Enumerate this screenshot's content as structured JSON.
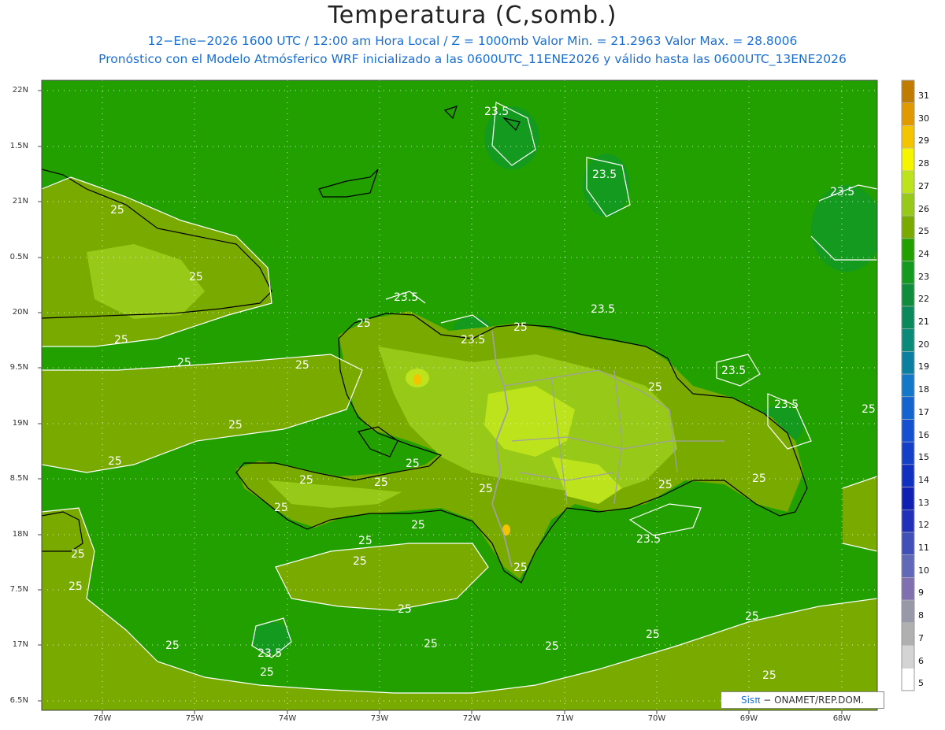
{
  "header": {
    "title": "Temperatura (C,somb.)",
    "subtitle1": "12−Ene−2026 1600 UTC / 12:00 am Hora Local / Z = 1000mb  Valor Min. = 21.2963  Valor Max. = 28.8006",
    "subtitle2": "Pronóstico con el Modelo Atmósferico WRF inicializado a las 0600UTC_11ENE2026 y válido hasta las  0600UTC_13ENE2026"
  },
  "axes": {
    "lat_labels": [
      "22N",
      "1.5N",
      "21N",
      "0.5N",
      "20N",
      "9.5N",
      "19N",
      "8.5N",
      "18N",
      "7.5N",
      "17N",
      "6.5N"
    ],
    "lon_labels": [
      "76W",
      "75W",
      "74W",
      "73W",
      "72W",
      "71W",
      "70W",
      "69W",
      "68W"
    ],
    "grid": true
  },
  "colorbar": {
    "levels": [
      "31",
      "30",
      "29",
      "28",
      "27",
      "26",
      "25",
      "24",
      "23",
      "22",
      "21",
      "20",
      "19",
      "18",
      "17",
      "16",
      "15",
      "14",
      "13",
      "12",
      "11",
      "10",
      "9",
      "8",
      "7",
      "6",
      "5"
    ],
    "colors": [
      "#c07c00",
      "#e09a00",
      "#f5c400",
      "#f5f500",
      "#bde31d",
      "#97c918",
      "#78aa00",
      "#22a000",
      "#149a1f",
      "#0f8c3c",
      "#0a8a5c",
      "#0a8a78",
      "#0a7fa0",
      "#1478c8",
      "#1464d0",
      "#1450d0",
      "#1440c8",
      "#1030c0",
      "#1020b0",
      "#2030b8",
      "#4050b8",
      "#6068b8",
      "#8070b0",
      "#9898a8",
      "#b0b0b0",
      "#d4d4d4",
      "#ffffff"
    ]
  },
  "contour_labels": {
    "c25": "25",
    "c235": "23.5"
  },
  "credit": {
    "brand": "Sisπ",
    "text": " − ONAMET/REP.DOM."
  },
  "colors": {
    "sea": "#22a000",
    "land_main": "#78aa00",
    "land_warm": "#97c918",
    "land_hot": "#bde31d",
    "land_peak": "#f5c400",
    "sea_cool": "#149a1f"
  }
}
